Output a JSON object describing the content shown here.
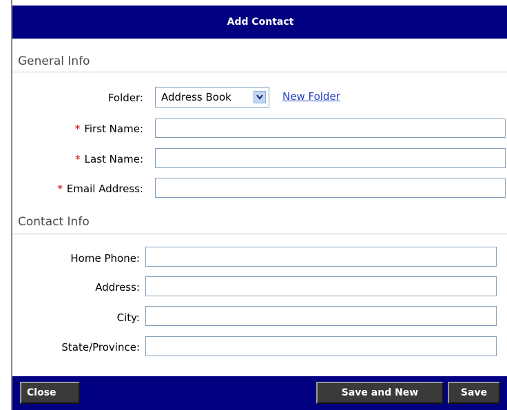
{
  "dialog": {
    "title": "Add Contact"
  },
  "general": {
    "heading": "General Info",
    "folder_label": "Folder:",
    "folder_value": "Address Book",
    "new_folder_link": "New Folder",
    "required_marker": "*",
    "first_name_label": "First Name:",
    "first_name_value": "",
    "last_name_label": "Last Name:",
    "last_name_value": "",
    "email_label": "Email Address:",
    "email_value": ""
  },
  "contact": {
    "heading": "Contact Info",
    "home_phone_label": "Home Phone:",
    "home_phone_value": "",
    "address_label": "Address:",
    "address_value": "",
    "city_label": "City:",
    "city_value": "",
    "state_label": "State/Province:",
    "state_value": ""
  },
  "footer": {
    "close_label": "Close",
    "save_new_label": "Save and New",
    "save_label": "Save"
  },
  "colors": {
    "bar": "#000080",
    "button": "#3a3a3a",
    "required": "#cc0000",
    "link": "#1f3fbf"
  },
  "icons": {
    "dropdown": "chevron-down-icon"
  }
}
